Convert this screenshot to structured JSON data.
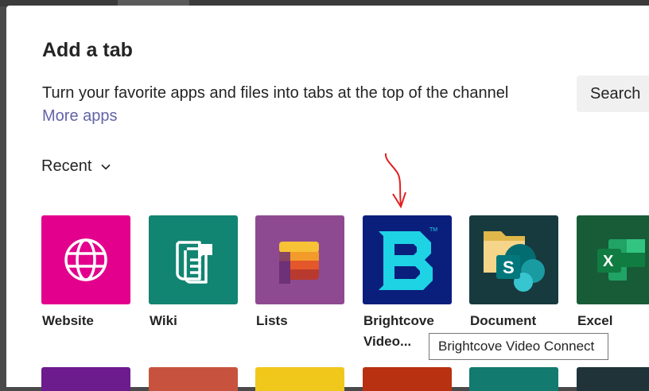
{
  "dialog": {
    "title": "Add a tab",
    "subtitle": "Turn your favorite apps and files into tabs at the top of the channel",
    "more_apps": "More apps",
    "search_placeholder": "Search"
  },
  "filter": {
    "label": "Recent",
    "icon": "chevron-down-icon"
  },
  "apps": [
    {
      "name": "Website",
      "icon": "globe-icon",
      "color": "#e3008c"
    },
    {
      "name": "Wiki",
      "icon": "wiki-icon",
      "color": "#128472"
    },
    {
      "name": "Lists",
      "icon": "lists-icon",
      "color": "#8e4a91"
    },
    {
      "name": "Brightcove Video...",
      "icon": "brightcove-icon",
      "color": "#0a1e7c"
    },
    {
      "name": "Document",
      "icon": "sharepoint-folder-icon",
      "color": "#173a3f"
    },
    {
      "name": "Excel",
      "icon": "excel-icon",
      "color": "#185c37"
    }
  ],
  "tooltip": "Brightcove Video Connect",
  "second_row_colors": [
    "#6c1c8c",
    "#c7533f",
    "#f0c81c",
    "#b83212",
    "#127a6f",
    "#1f3338"
  ]
}
